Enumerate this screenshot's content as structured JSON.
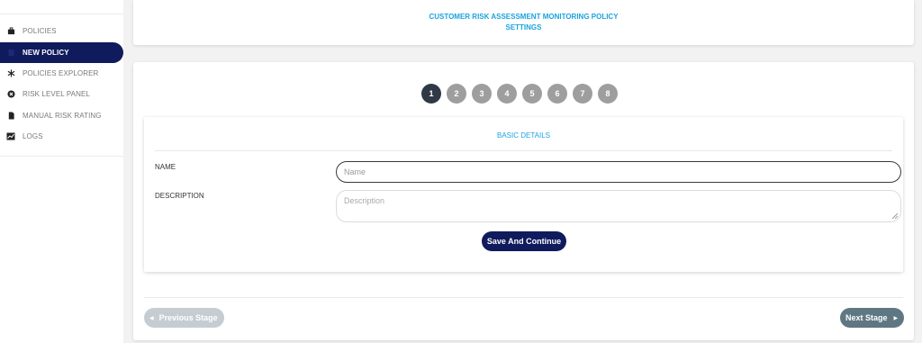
{
  "sidebar": {
    "items": [
      {
        "label": "POLICIES",
        "icon": "briefcase-icon"
      },
      {
        "label": "NEW POLICY",
        "icon": "new-policy-icon"
      },
      {
        "label": "POLICIES EXPLORER",
        "icon": "snowflake-icon"
      },
      {
        "label": "RISK LEVEL PANEL",
        "icon": "circle-x-icon"
      },
      {
        "label": "MANUAL RISK RATING",
        "icon": "document-icon"
      },
      {
        "label": "LOGS",
        "icon": "chart-icon"
      }
    ],
    "active_index": 1
  },
  "header": {
    "title_line1": "CUSTOMER RISK ASSESSMENT MONITORING POLICY",
    "title_line2": "SETTINGS"
  },
  "stepper": {
    "steps": [
      "1",
      "2",
      "3",
      "4",
      "5",
      "6",
      "7",
      "8"
    ],
    "active": "1"
  },
  "form": {
    "section_title": "BASIC DETAILS",
    "name_label": "NAME",
    "name_placeholder": "Name",
    "description_label": "DESCRIPTION",
    "description_placeholder": "Description",
    "save_label": "Save And Continue"
  },
  "footer": {
    "previous_label": "Previous Stage",
    "next_label": "Next Stage"
  },
  "colors": {
    "accent": "#1aa3e0",
    "primary": "#0f1b5c",
    "step_active": "#2f3a46",
    "step_inactive": "#9e9e9e",
    "next_button": "#5f7783",
    "previous_button_disabled": "#c5cdd3"
  }
}
